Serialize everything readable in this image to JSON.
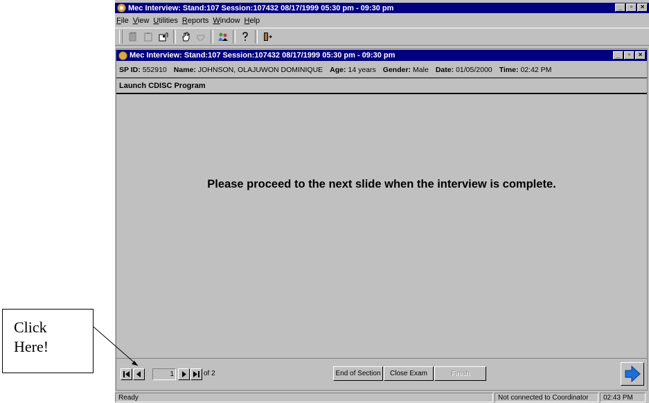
{
  "app": {
    "title": "Mec Interview: Stand:107 Session:107432 08/17/1999 05:30 pm - 09:30 pm",
    "window_buttons": [
      "_",
      "▫",
      "×"
    ]
  },
  "menu": {
    "items": [
      {
        "label": "File",
        "accel": "F",
        "rest": "ile"
      },
      {
        "label": "View",
        "accel": "V",
        "rest": "iew"
      },
      {
        "label": "Utilities",
        "accel": "U",
        "rest": "tilities"
      },
      {
        "label": "Reports",
        "accel": "R",
        "rest": "eports"
      },
      {
        "label": "Window",
        "accel": "W",
        "rest": "indow"
      },
      {
        "label": "Help",
        "accel": "H",
        "rest": "elp"
      }
    ]
  },
  "toolbar": {
    "icons": [
      "new-icon",
      "clipboard-icon",
      "open-icon",
      "hand-icon",
      "disabled-hand-icon",
      "people-icon",
      "help-icon",
      "exit-icon"
    ]
  },
  "inner": {
    "title": "Mec Interview: Stand:107 Session:107432 08/17/1999 05:30 pm - 09:30 pm",
    "sp_id_label": "SP ID:",
    "sp_id": "552910",
    "name_label": "Name:",
    "name": "JOHNSON, OLAJUWON DOMINIQUE",
    "age_label": "Age:",
    "age": "14 years",
    "gender_label": "Gender:",
    "gender": "Male",
    "date_label": "Date:",
    "date": "01/05/2000",
    "time_label": "Time:",
    "time": "02:42 PM",
    "section_title": "Launch CDISC Program",
    "message": "Please proceed to the next slide when the interview is complete."
  },
  "nav": {
    "page_value": "1",
    "of_text": "of 2",
    "end_of_section": "End of Section",
    "close_exam": "Close Exam",
    "finish": "Finish"
  },
  "status": {
    "ready": "Ready",
    "connection": "Not connected to Coordinator",
    "clock": "02:43 PM"
  },
  "callout": {
    "line1": "Click",
    "line2": "Here!"
  },
  "colors": {
    "titlebar": "#000080",
    "face": "#c0c0c0",
    "next_arrow": "#1e6fd6"
  }
}
